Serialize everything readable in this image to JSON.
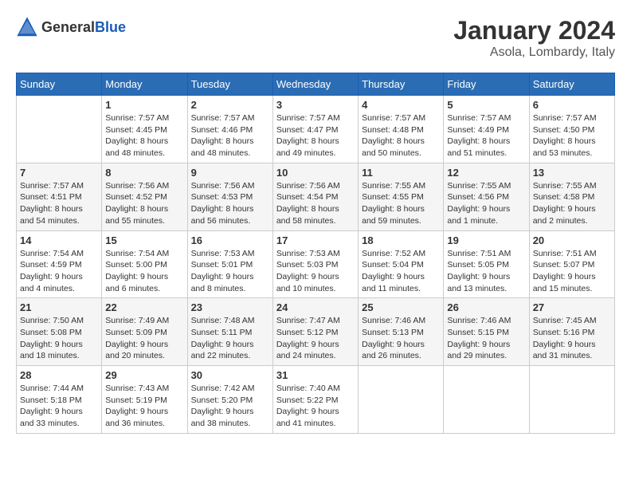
{
  "header": {
    "logo": {
      "text_general": "General",
      "text_blue": "Blue"
    },
    "title": "January 2024",
    "location": "Asola, Lombardy, Italy"
  },
  "calendar": {
    "days_of_week": [
      "Sunday",
      "Monday",
      "Tuesday",
      "Wednesday",
      "Thursday",
      "Friday",
      "Saturday"
    ],
    "weeks": [
      [
        {
          "day": "",
          "info": ""
        },
        {
          "day": "1",
          "info": "Sunrise: 7:57 AM\nSunset: 4:45 PM\nDaylight: 8 hours\nand 48 minutes."
        },
        {
          "day": "2",
          "info": "Sunrise: 7:57 AM\nSunset: 4:46 PM\nDaylight: 8 hours\nand 48 minutes."
        },
        {
          "day": "3",
          "info": "Sunrise: 7:57 AM\nSunset: 4:47 PM\nDaylight: 8 hours\nand 49 minutes."
        },
        {
          "day": "4",
          "info": "Sunrise: 7:57 AM\nSunset: 4:48 PM\nDaylight: 8 hours\nand 50 minutes."
        },
        {
          "day": "5",
          "info": "Sunrise: 7:57 AM\nSunset: 4:49 PM\nDaylight: 8 hours\nand 51 minutes."
        },
        {
          "day": "6",
          "info": "Sunrise: 7:57 AM\nSunset: 4:50 PM\nDaylight: 8 hours\nand 53 minutes."
        }
      ],
      [
        {
          "day": "7",
          "info": "Sunrise: 7:57 AM\nSunset: 4:51 PM\nDaylight: 8 hours\nand 54 minutes."
        },
        {
          "day": "8",
          "info": "Sunrise: 7:56 AM\nSunset: 4:52 PM\nDaylight: 8 hours\nand 55 minutes."
        },
        {
          "day": "9",
          "info": "Sunrise: 7:56 AM\nSunset: 4:53 PM\nDaylight: 8 hours\nand 56 minutes."
        },
        {
          "day": "10",
          "info": "Sunrise: 7:56 AM\nSunset: 4:54 PM\nDaylight: 8 hours\nand 58 minutes."
        },
        {
          "day": "11",
          "info": "Sunrise: 7:55 AM\nSunset: 4:55 PM\nDaylight: 8 hours\nand 59 minutes."
        },
        {
          "day": "12",
          "info": "Sunrise: 7:55 AM\nSunset: 4:56 PM\nDaylight: 9 hours\nand 1 minute."
        },
        {
          "day": "13",
          "info": "Sunrise: 7:55 AM\nSunset: 4:58 PM\nDaylight: 9 hours\nand 2 minutes."
        }
      ],
      [
        {
          "day": "14",
          "info": "Sunrise: 7:54 AM\nSunset: 4:59 PM\nDaylight: 9 hours\nand 4 minutes."
        },
        {
          "day": "15",
          "info": "Sunrise: 7:54 AM\nSunset: 5:00 PM\nDaylight: 9 hours\nand 6 minutes."
        },
        {
          "day": "16",
          "info": "Sunrise: 7:53 AM\nSunset: 5:01 PM\nDaylight: 9 hours\nand 8 minutes."
        },
        {
          "day": "17",
          "info": "Sunrise: 7:53 AM\nSunset: 5:03 PM\nDaylight: 9 hours\nand 10 minutes."
        },
        {
          "day": "18",
          "info": "Sunrise: 7:52 AM\nSunset: 5:04 PM\nDaylight: 9 hours\nand 11 minutes."
        },
        {
          "day": "19",
          "info": "Sunrise: 7:51 AM\nSunset: 5:05 PM\nDaylight: 9 hours\nand 13 minutes."
        },
        {
          "day": "20",
          "info": "Sunrise: 7:51 AM\nSunset: 5:07 PM\nDaylight: 9 hours\nand 15 minutes."
        }
      ],
      [
        {
          "day": "21",
          "info": "Sunrise: 7:50 AM\nSunset: 5:08 PM\nDaylight: 9 hours\nand 18 minutes."
        },
        {
          "day": "22",
          "info": "Sunrise: 7:49 AM\nSunset: 5:09 PM\nDaylight: 9 hours\nand 20 minutes."
        },
        {
          "day": "23",
          "info": "Sunrise: 7:48 AM\nSunset: 5:11 PM\nDaylight: 9 hours\nand 22 minutes."
        },
        {
          "day": "24",
          "info": "Sunrise: 7:47 AM\nSunset: 5:12 PM\nDaylight: 9 hours\nand 24 minutes."
        },
        {
          "day": "25",
          "info": "Sunrise: 7:46 AM\nSunset: 5:13 PM\nDaylight: 9 hours\nand 26 minutes."
        },
        {
          "day": "26",
          "info": "Sunrise: 7:46 AM\nSunset: 5:15 PM\nDaylight: 9 hours\nand 29 minutes."
        },
        {
          "day": "27",
          "info": "Sunrise: 7:45 AM\nSunset: 5:16 PM\nDaylight: 9 hours\nand 31 minutes."
        }
      ],
      [
        {
          "day": "28",
          "info": "Sunrise: 7:44 AM\nSunset: 5:18 PM\nDaylight: 9 hours\nand 33 minutes."
        },
        {
          "day": "29",
          "info": "Sunrise: 7:43 AM\nSunset: 5:19 PM\nDaylight: 9 hours\nand 36 minutes."
        },
        {
          "day": "30",
          "info": "Sunrise: 7:42 AM\nSunset: 5:20 PM\nDaylight: 9 hours\nand 38 minutes."
        },
        {
          "day": "31",
          "info": "Sunrise: 7:40 AM\nSunset: 5:22 PM\nDaylight: 9 hours\nand 41 minutes."
        },
        {
          "day": "",
          "info": ""
        },
        {
          "day": "",
          "info": ""
        },
        {
          "day": "",
          "info": ""
        }
      ]
    ]
  }
}
